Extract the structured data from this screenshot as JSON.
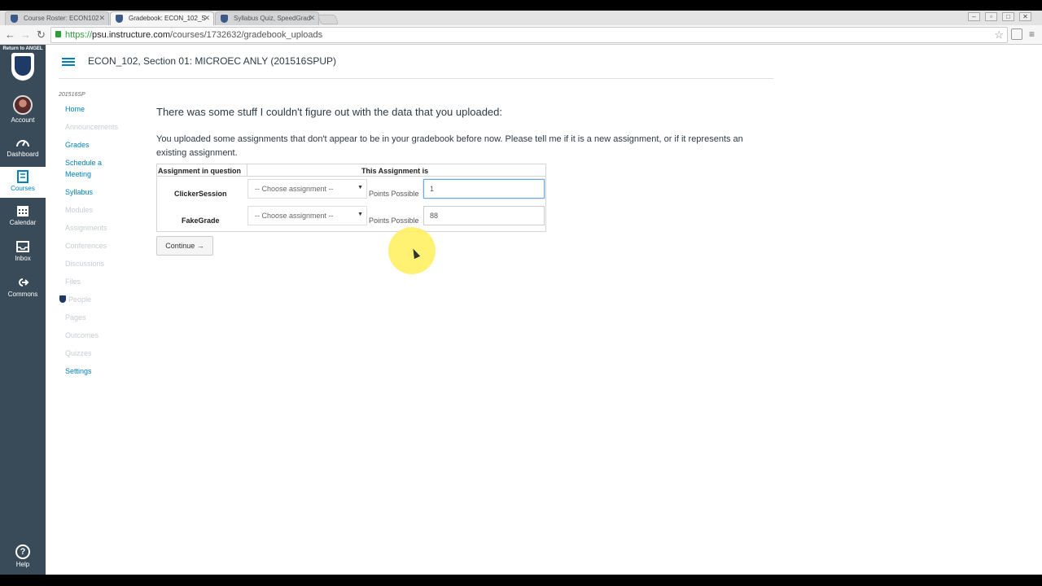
{
  "browser": {
    "tabs": [
      {
        "title": "Course Roster: ECON102"
      },
      {
        "title": "Gradebook: ECON_102_S"
      },
      {
        "title": "Syllabus Quiz, SpeedGrad"
      }
    ],
    "url_scheme": "https://",
    "url_host": "psu.instructure.com",
    "url_path": "/courses/1732632/gradebook_uploads"
  },
  "global_nav": {
    "logo_label": "Return to ANGEL",
    "items": [
      {
        "label": "Account",
        "icon": "avatar"
      },
      {
        "label": "Dashboard",
        "icon": "dashboard-icon"
      },
      {
        "label": "Courses",
        "icon": "courses-icon"
      },
      {
        "label": "Calendar",
        "icon": "calendar-icon"
      },
      {
        "label": "Inbox",
        "icon": "inbox-icon"
      },
      {
        "label": "Commons",
        "icon": "commons-icon"
      }
    ],
    "help_label": "Help",
    "bg_color": "#394b58",
    "accent_color": "#0081bd"
  },
  "header": {
    "course_title": "ECON_102, Section 01: MICROEC ANLY (201516SPUP)"
  },
  "course_nav": {
    "term": "201516SP",
    "items": [
      {
        "label": "Home"
      },
      {
        "label": "Announcements"
      },
      {
        "label": "Grades"
      },
      {
        "label": "Schedule a Meeting"
      },
      {
        "label": "Syllabus"
      },
      {
        "label": "Modules"
      },
      {
        "label": "Assignments"
      },
      {
        "label": "Conferences"
      },
      {
        "label": "Discussions"
      },
      {
        "label": "Files"
      },
      {
        "label": "People"
      },
      {
        "label": "Pages"
      },
      {
        "label": "Outcomes"
      },
      {
        "label": "Quizzes"
      },
      {
        "label": "Settings"
      }
    ]
  },
  "main": {
    "heading": "There was some stuff I couldn't figure out with the data that you uploaded:",
    "description": "You uploaded some assignments that don't appear to be in your gradebook before now. Please tell me if it is a new assignment, or if it represents an existing assignment.",
    "table": {
      "col_assignment": "Assignment in question",
      "col_this_is": "This Assignment is",
      "rows": [
        {
          "name": "ClickerSession",
          "select": "-- Choose assignment --",
          "points_label": "Points Possible",
          "points": "1"
        },
        {
          "name": "FakeGrade",
          "select": "-- Choose assignment --",
          "points_label": "Points Possible",
          "points": "88"
        }
      ]
    },
    "continue_label": "Continue →"
  }
}
